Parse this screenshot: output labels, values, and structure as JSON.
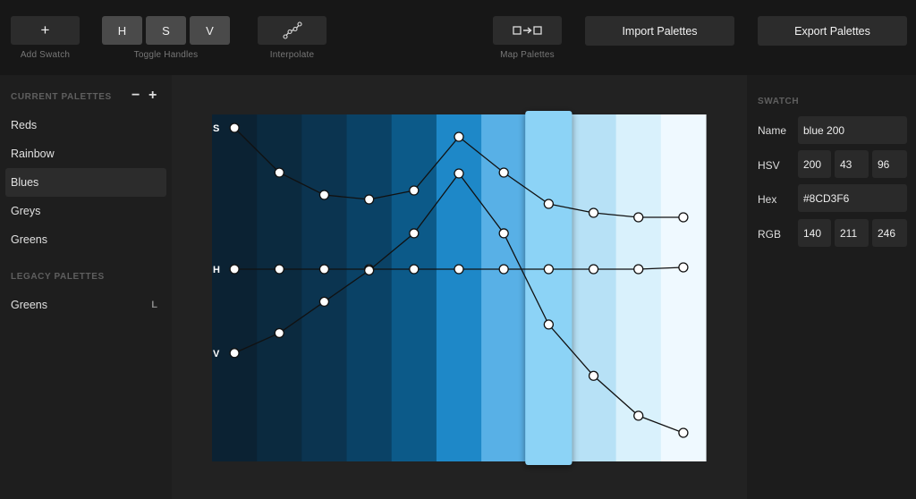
{
  "toolbar": {
    "add_swatch": {
      "icon": "+",
      "label": "Add Swatch"
    },
    "toggle_handles": {
      "buttons": [
        "H",
        "S",
        "V"
      ],
      "label": "Toggle Handles"
    },
    "interpolate": {
      "label": "Interpolate",
      "icon": "interpolate-curve-icon"
    },
    "map_palettes": {
      "label": "Map Palettes",
      "icon": "map-arrow-icon"
    },
    "import": "Import Palettes",
    "export": "Export Palettes"
  },
  "sidebar": {
    "current_title": "CURRENT PALETTES",
    "remove_icon": "−",
    "add_icon": "+",
    "current": [
      {
        "label": "Reds",
        "active": false
      },
      {
        "label": "Rainbow",
        "active": false
      },
      {
        "label": "Blues",
        "active": true
      },
      {
        "label": "Greys",
        "active": false
      },
      {
        "label": "Greens",
        "active": false
      }
    ],
    "legacy_title": "LEGACY PALETTES",
    "legacy": [
      {
        "label": "Greens",
        "badge": "L"
      }
    ]
  },
  "editor": {
    "selected_index": 7,
    "swatch_colors": [
      "#0B2233",
      "#0B2A3F",
      "#0B3450",
      "#0A4266",
      "#0C5A89",
      "#1E88C8",
      "#58B0E6",
      "#8CD3F6",
      "#B7E1F6",
      "#D9F1FC",
      "#EFF9FF"
    ],
    "curve_labels": {
      "S": "S",
      "H": "H",
      "V": "V"
    },
    "curves": {
      "S": [
        100,
        90,
        85,
        84,
        86,
        98,
        90,
        83,
        81,
        80,
        80
      ],
      "H": [
        200,
        200,
        200,
        200,
        200,
        200,
        200,
        200,
        200,
        200,
        201
      ],
      "V": [
        33,
        40,
        51,
        62,
        75,
        96,
        75,
        43,
        25,
        11,
        5
      ]
    }
  },
  "swatch": {
    "title": "SWATCH",
    "name_label": "Name",
    "name": "blue 200",
    "hsv_label": "HSV",
    "hsv": [
      "200",
      "43",
      "96"
    ],
    "hex_label": "Hex",
    "hex": "#8CD3F6",
    "rgb_label": "RGB",
    "rgb": [
      "140",
      "211",
      "246"
    ]
  }
}
